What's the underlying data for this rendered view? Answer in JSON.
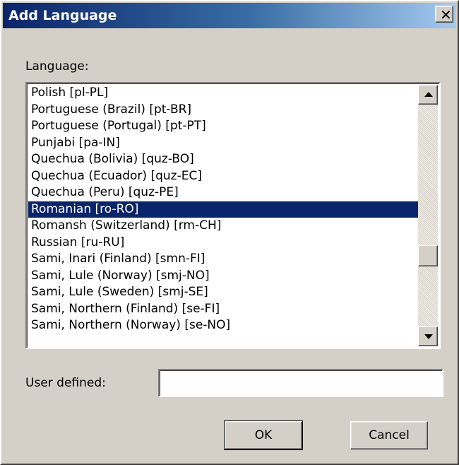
{
  "window": {
    "title": "Add Language",
    "close_glyph": "✕",
    "close_icon": "close-icon"
  },
  "language_label": "Language:",
  "languages": {
    "items": [
      "Polish [pl-PL]",
      "Portuguese (Brazil) [pt-BR]",
      "Portuguese (Portugal) [pt-PT]",
      "Punjabi [pa-IN]",
      "Quechua (Bolivia) [quz-BO]",
      "Quechua (Ecuador) [quz-EC]",
      "Quechua (Peru) [quz-PE]",
      "Romanian [ro-RO]",
      "Romansh (Switzerland) [rm-CH]",
      "Russian [ru-RU]",
      "Sami, Inari (Finland) [smn-FI]",
      "Sami, Lule (Norway) [smj-NO]",
      "Sami, Lule (Sweden) [smj-SE]",
      "Sami, Northern (Finland) [se-FI]",
      "Sami, Northern (Norway) [se-NO]"
    ],
    "selected": "Romanian [ro-RO]",
    "scroll_position": 0.7
  },
  "user_defined": {
    "label": "User defined:",
    "value": "",
    "placeholder": ""
  },
  "buttons": {
    "ok": "OK",
    "cancel": "Cancel"
  },
  "colors": {
    "face": "#d4d0c8",
    "title_start": "#0a246a",
    "title_end": "#a6caf0",
    "selection": "#0a246a"
  }
}
